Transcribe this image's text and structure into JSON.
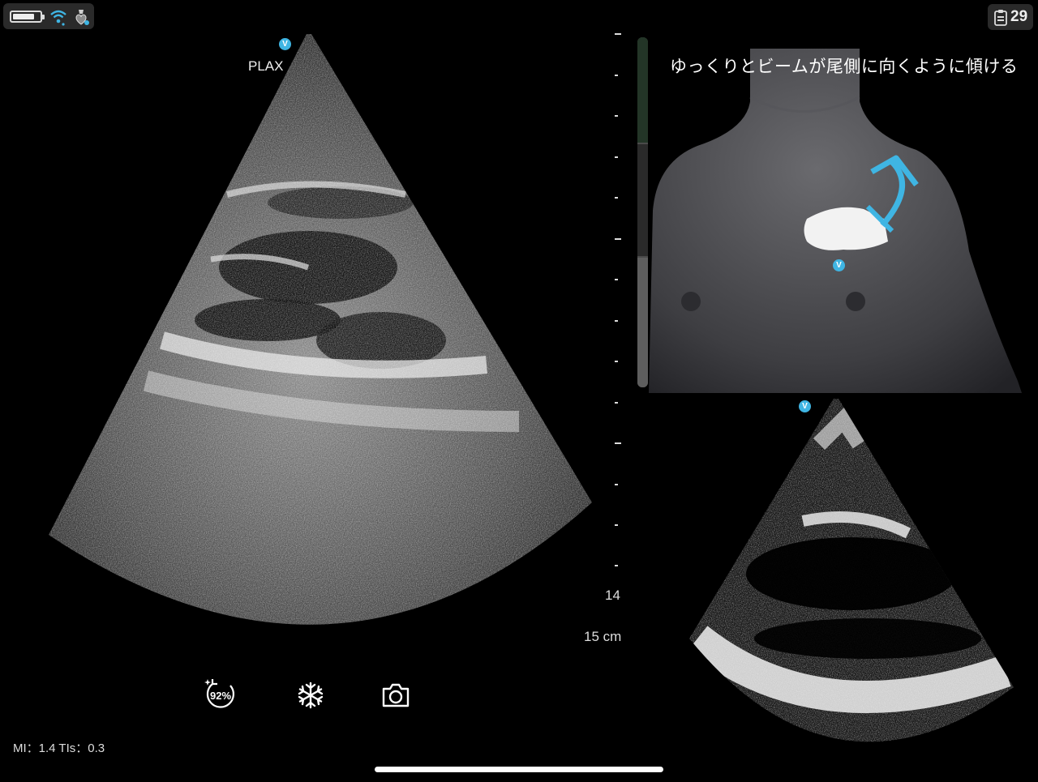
{
  "status_bar": {
    "battery_icon": "battery-icon",
    "wifi_icon": "wifi-icon",
    "device_icon": "heart-probe-icon",
    "clip_icon": "clipboard-icon",
    "clip_count": "29"
  },
  "main_view": {
    "view_label": "PLAX",
    "orientation_marker": "V"
  },
  "guidance": {
    "instruction": "ゆっくりとビームが尾側に向くように傾ける",
    "orientation_marker": "V",
    "arrow_color": "#3fb5e3"
  },
  "reference_view": {
    "orientation_marker": "V"
  },
  "depth_scale": {
    "label_14": "14",
    "label_depth": "15 cm"
  },
  "quality_indicator": {
    "colors": [
      "#233527",
      "#2a2a2a",
      "#5e5e5e"
    ]
  },
  "controls": {
    "auto_preset_label": "92%",
    "auto_preset_icon": "auto-quality-icon",
    "freeze_icon": "snowflake-icon",
    "capture_icon": "camera-icon"
  },
  "readout": {
    "mi_tis": "MI：1.4  TIs：0.3"
  },
  "accent_color": "#3fb5e3"
}
